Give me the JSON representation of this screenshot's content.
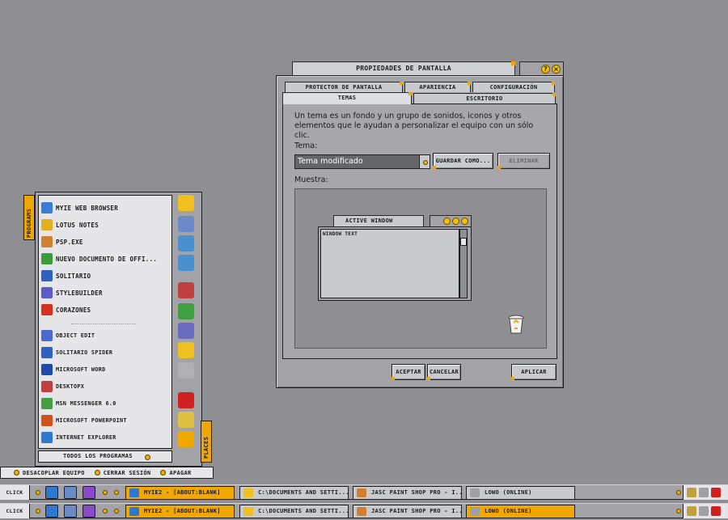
{
  "dialog": {
    "title": "Propiedades de pantalla",
    "tabs_back": [
      "Protector de pantalla",
      "Apariencia",
      "Configuración"
    ],
    "tabs_front": [
      "Temas",
      "Escritorio"
    ],
    "description": "Un tema es un fondo y un grupo de sonidos, iconos y otros elementos que le ayudan a personalizar el equipo con un sólo clic.",
    "tema_label": "Tema:",
    "tema_value": "Tema modificado",
    "save_button": "Guardar como...",
    "delete_button": "Eliminar",
    "muestra_label": "Muestra:",
    "preview": {
      "tab": "Active Window",
      "text": "Window Text"
    },
    "ok_button": "Aceptar",
    "cancel_button": "Cancelar",
    "apply_button": "Aplicar"
  },
  "start_menu": {
    "programs_tab": "Programs",
    "places_tab": "Places",
    "pinned": [
      {
        "label": "MyIE Web Browser",
        "icon": "myie-icon",
        "color": "#3a7bd5"
      },
      {
        "label": "Lotus Notes",
        "icon": "lotus-notes-icon",
        "color": "#e0b020"
      },
      {
        "label": "PSP.EXE",
        "icon": "psp-icon",
        "color": "#d08030"
      },
      {
        "label": "Nuevo Documento de Offi...",
        "icon": "office-doc-icon",
        "color": "#3c9a3c"
      },
      {
        "label": "Solitario",
        "icon": "solitaire-icon",
        "color": "#3060c0"
      },
      {
        "label": "StyleBuilder",
        "icon": "stylebuilder-icon",
        "color": "#5a5ac8"
      },
      {
        "label": "Corazones",
        "icon": "hearts-icon",
        "color": "#d83020"
      }
    ],
    "recent": [
      {
        "label": "Object Edit",
        "icon": "object-edit-icon",
        "color": "#4a6ad0"
      },
      {
        "label": "Solitario Spider",
        "icon": "spider-solitaire-icon",
        "color": "#3060c0"
      },
      {
        "label": "Microsoft Word",
        "icon": "word-icon",
        "color": "#1e4aa8"
      },
      {
        "label": "DesktopX",
        "icon": "desktopx-icon",
        "color": "#c04040"
      },
      {
        "label": "MSN Messenger 6.0",
        "icon": "msn-icon",
        "color": "#40a040"
      },
      {
        "label": "Microsoft PowerPoint",
        "icon": "powerpoint-icon",
        "color": "#d05020"
      },
      {
        "label": "Internet Explorer",
        "icon": "ie-icon",
        "color": "#2f78d0"
      }
    ],
    "all_programs": "Todos los Programas",
    "side_icons": [
      {
        "icon": "folder-icon",
        "color": "#f0c020"
      },
      {
        "icon": "my-computer-icon",
        "color": "#6a8ac8"
      },
      {
        "icon": "monitor-icon",
        "color": "#4a90d0"
      },
      {
        "icon": "network-icon",
        "color": "#4a90d0"
      },
      {
        "icon": "tools-icon",
        "color": "#c04040"
      },
      {
        "icon": "control-panel-icon",
        "color": "#40a040"
      },
      {
        "icon": "programs-icon",
        "color": "#6a6ac0"
      },
      {
        "icon": "search-folder-icon",
        "color": "#f0c020"
      },
      {
        "icon": "printer-icon",
        "color": "#b0b0b4"
      },
      {
        "icon": "help-icon",
        "color": "#d02020"
      },
      {
        "icon": "search-icon",
        "color": "#e0c040"
      },
      {
        "icon": "settings-icon",
        "color": "#f0a800"
      }
    ],
    "session": [
      "Desacoplar equipo",
      "Cerrar sesión",
      "Apagar"
    ]
  },
  "taskbars": [
    {
      "start": "Click",
      "tasks": [
        {
          "label": "MyIE2 - [about:blank]",
          "active": true
        },
        {
          "label": "C:\\Documents and Setti...",
          "active": false
        },
        {
          "label": "Jasc Paint Shop Pro - I...",
          "active": false
        },
        {
          "label": "Lowo (online)",
          "active": false
        }
      ]
    },
    {
      "start": "Click",
      "tasks": [
        {
          "label": "MyIE2 - [about:blank]",
          "active": true
        },
        {
          "label": "C:\\Documents and Setti...",
          "active": false
        },
        {
          "label": "Jasc Paint Shop Pro - I...",
          "active": false
        },
        {
          "label": "Lowo (online)",
          "active": true
        }
      ]
    }
  ]
}
